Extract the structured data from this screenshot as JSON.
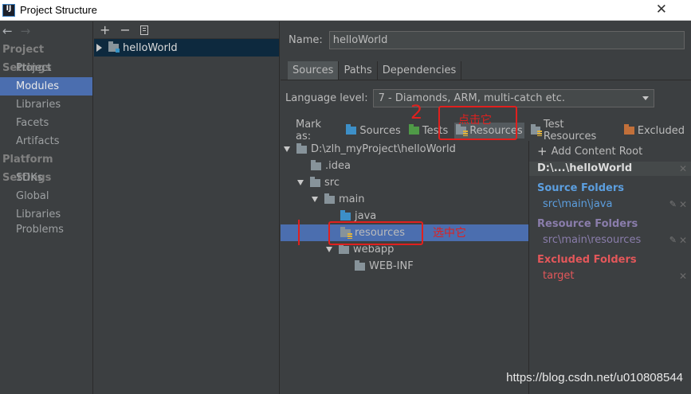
{
  "window": {
    "title": "Project Structure",
    "app_icon": "IJ",
    "close": "✕"
  },
  "nav": {
    "back": "←",
    "forward": "→",
    "project_settings": "Project Settings",
    "project_items": [
      "Project",
      "Modules",
      "Libraries",
      "Facets",
      "Artifacts"
    ],
    "platform_settings": "Platform Settings",
    "platform_items": [
      "SDKs",
      "Global Libraries"
    ],
    "problems": "Problems",
    "selected": "Modules"
  },
  "modules": {
    "toolbar": {
      "add": "+",
      "remove": "−"
    },
    "items": [
      "helloWorld"
    ]
  },
  "detail": {
    "name_label": "Name:",
    "name_value": "helloWorld",
    "tabs": [
      "Sources",
      "Paths",
      "Dependencies"
    ],
    "active_tab": "Sources",
    "language_label": "Language level:",
    "language_value": "7 - Diamonds, ARM, multi-catch etc.",
    "mark_as_label": "Mark as:",
    "mark_as": [
      "Sources",
      "Tests",
      "Resources",
      "Test Resources",
      "Excluded"
    ]
  },
  "tree": {
    "rows": [
      "D:\\zlh_myProject\\helloWorld",
      ".idea",
      "src",
      "main",
      "java",
      "resources",
      "webapp",
      "WEB-INF"
    ],
    "selected": "resources"
  },
  "content_roots": {
    "add_label": "Add Content Root",
    "root": "D:\\...\\helloWorld",
    "source_title": "Source Folders",
    "source_path": "src\\main\\java",
    "resource_title": "Resource Folders",
    "resource_path": "src\\main\\resources",
    "excluded_title": "Excluded Folders",
    "excluded_path": "target"
  },
  "annotations": {
    "step_number": "2",
    "click_it": "点击它",
    "select_it": "选中它"
  },
  "watermark": "https://blog.csdn.net/u010808544",
  "colors": {
    "selection": "#4b6eaf",
    "source": "#5c9fe0",
    "resource": "#8a7dab",
    "excluded": "#e2575a",
    "annotation": "#e0201e"
  }
}
